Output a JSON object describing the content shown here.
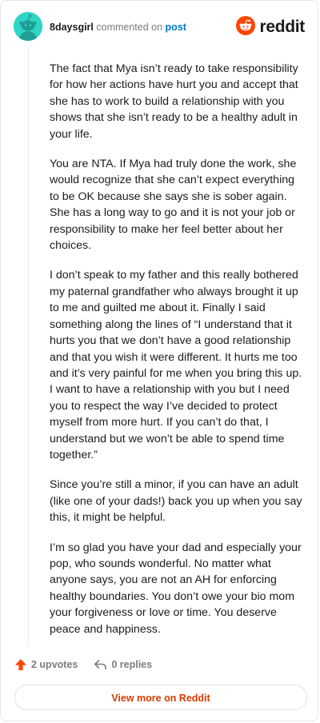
{
  "header": {
    "username": "8daysgirl",
    "action_text": "commented on",
    "post_link": "post",
    "brand_name": "reddit"
  },
  "comment": {
    "paragraphs": [
      "The fact that Mya isn’t ready to take responsibility for how her actions have hurt you and accept that she has to work to build a relationship with you shows that she isn’t ready to be a healthy adult in your life.",
      "You are NTA. If Mya had truly done the work, she would recognize that she can’t expect everything to be OK because she says she is sober again. She has a long way to go and it is not your job or responsibility to make her feel better about her choices.",
      "I don’t speak to my father and this really bothered my paternal grandfather who always brought it up to me and guilted me about it. Finally I said something along the lines of “I understand that it hurts you that we don’t have a good relationship and that you wish it were different. It hurts me too and it’s very painful for me when you bring this up. I want to have a relationship with you but I need you to respect the way I’ve decided to protect myself from more hurt. If you can’t do that, I understand but we won’t be able to spend time together.”",
      "Since you’re still a minor, if you can have an adult (like one of your dads!) back you up when you say this, it might be helpful.",
      "I’m so glad you have your dad and especially your pop, who sounds wonderful. No matter what anyone says, you are not an AH for enforcing healthy boundaries. You don’t owe your bio mom your forgiveness or love or time. You deserve peace and happiness."
    ]
  },
  "actions": {
    "upvotes": "2 upvotes",
    "replies": "0 replies"
  },
  "footer": {
    "view_more": "View more on Reddit"
  },
  "icons": {
    "avatar": "snoo-avatar-icon",
    "brand": "reddit-logo-icon",
    "upvote": "upvote-arrow-icon",
    "reply": "reply-arrow-icon"
  },
  "colors": {
    "brand_orange": "#ff4500",
    "link_blue": "#0079d3",
    "avatar_teal": "#2fd5c5",
    "cta_text": "#d93a00"
  }
}
